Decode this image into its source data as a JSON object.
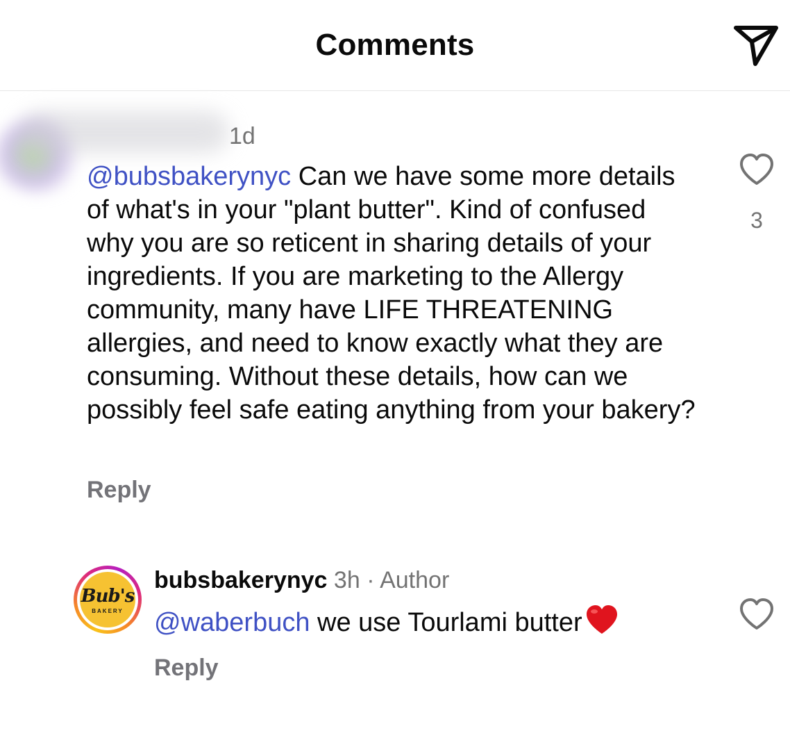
{
  "header": {
    "title": "Comments",
    "share_icon": "paper-plane-icon"
  },
  "comments": [
    {
      "time": "1d",
      "mention": "@bubsbakerynyc",
      "text": " Can we have some more details of what's in  your \"plant butter\". Kind of confused why you are so reticent in sharing details of your ingredients. If you are marketing to the Allergy community, many have LIFE THREATENING allergies, and need to know exactly what they are consuming. Without these details, how can we possibly feel safe eating anything from your bakery?",
      "reply_label": "Reply",
      "like_count": "3",
      "like_icon": "heart-outline-icon"
    },
    {
      "username": "bubsbakerynyc",
      "time": "3h",
      "separator": "·",
      "author_label": "Author",
      "mention": "@waberbuch",
      "text": " we use Tourlami butter",
      "emoji": "❤️",
      "reply_label": "Reply",
      "like_icon": "heart-outline-icon",
      "avatar": {
        "logo_text": "Bub's",
        "logo_subtext": "BAKERY",
        "logo_color": "#f6c232"
      }
    }
  ],
  "colors": {
    "mention": "#3f51c4",
    "secondary_text": "#737373",
    "primary_text": "#0a0a0a"
  }
}
